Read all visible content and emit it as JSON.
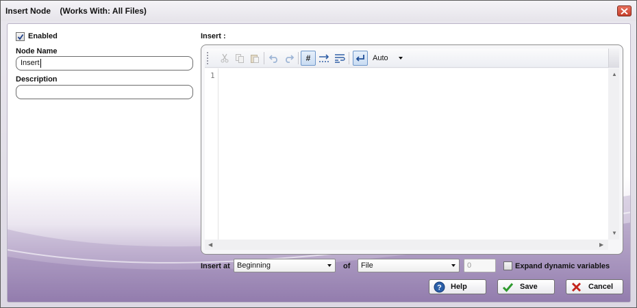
{
  "window": {
    "title": "Insert Node    (Works With: All Files)"
  },
  "left_panel": {
    "enabled_label": "Enabled",
    "enabled_checked": true,
    "node_name_label": "Node Name",
    "node_name_value": "Insert",
    "description_label": "Description",
    "description_value": ""
  },
  "insert_panel": {
    "label": "Insert :",
    "toolbar": {
      "items": [
        "cut-icon",
        "copy-icon",
        "paste-icon",
        "undo-icon",
        "redo-icon",
        "line-numbers-icon",
        "whitespace-icon",
        "word-wrap-icon",
        "enter-icon"
      ],
      "encoding_value": "Auto"
    },
    "editor": {
      "line_number": "1",
      "content": ""
    }
  },
  "options": {
    "insert_at_label": "Insert at",
    "insert_at_value": "Beginning",
    "of_label": "of",
    "of_value": "File",
    "offset_value": "0",
    "expand_label": "Expand dynamic variables",
    "expand_checked": false
  },
  "buttons": {
    "help": "Help",
    "save": "Save",
    "cancel": "Cancel"
  },
  "colors": {
    "accent_purple": "#8e78a9",
    "close_red": "#c7402c",
    "save_green": "#2e9a2e",
    "cancel_red": "#c4241c",
    "help_blue": "#2b5fa8"
  }
}
